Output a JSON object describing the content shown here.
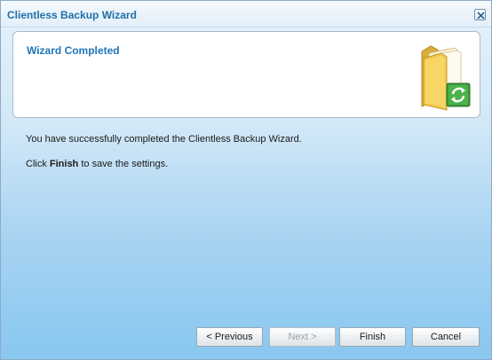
{
  "window": {
    "title": "Clientless Backup Wizard",
    "close_label": "×"
  },
  "header": {
    "title": "Wizard Completed",
    "icon": "folder-sync-icon"
  },
  "content": {
    "message": "You have successfully completed the Clientless Backup Wizard.",
    "instruction_prefix": "Click ",
    "instruction_bold": "Finish",
    "instruction_suffix": " to save the settings."
  },
  "buttons": {
    "previous": "< Previous",
    "next": "Next >",
    "finish": "Finish",
    "cancel": "Cancel"
  },
  "colors": {
    "title": "#1f6fa8",
    "header_title": "#1f76b8",
    "folder": "#f2c94c",
    "sync": "#3c9a3c"
  }
}
